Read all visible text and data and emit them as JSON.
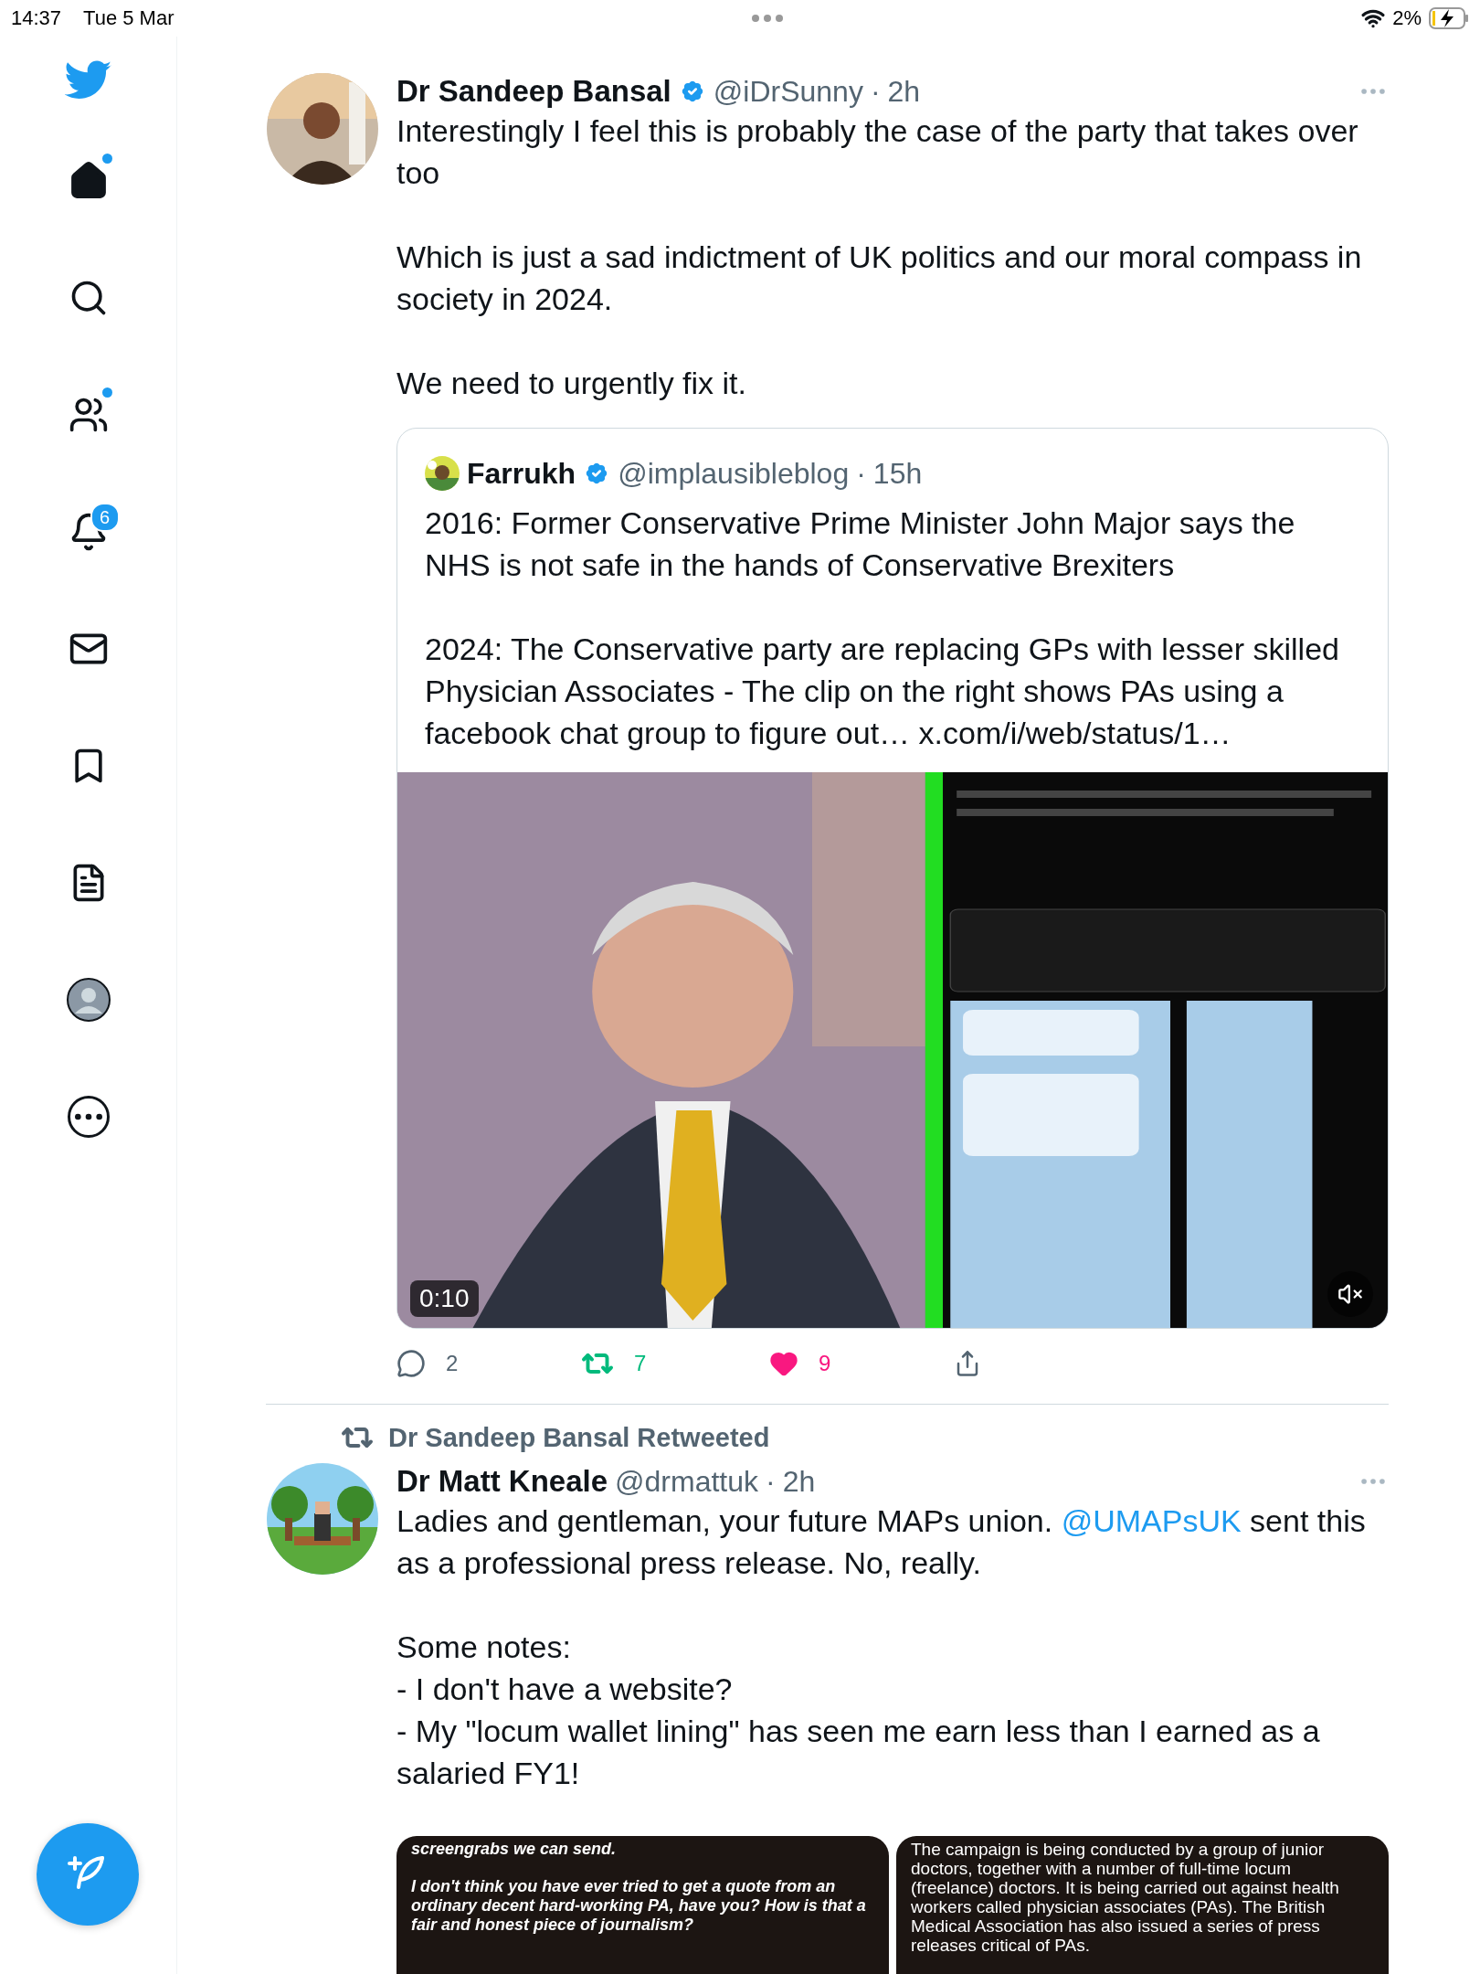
{
  "status_bar": {
    "time": "14:37",
    "date": "Tue 5 Mar",
    "battery": "2%",
    "charging": true
  },
  "sidebar": {
    "items": [
      {
        "kind": "home",
        "selected": true,
        "has_new": true
      },
      {
        "kind": "search",
        "selected": false,
        "has_new": false
      },
      {
        "kind": "communities",
        "selected": false,
        "has_new": true
      },
      {
        "kind": "notifications",
        "selected": false,
        "has_new": false,
        "badge": "6"
      },
      {
        "kind": "messages",
        "selected": false,
        "has_new": false
      },
      {
        "kind": "bookmarks",
        "selected": false,
        "has_new": false
      },
      {
        "kind": "lists",
        "selected": false,
        "has_new": false
      },
      {
        "kind": "profile",
        "selected": false,
        "has_new": false
      },
      {
        "kind": "more",
        "selected": false,
        "has_new": false
      }
    ]
  },
  "tweets": [
    {
      "name": "Dr Sandeep Bansal",
      "verified": true,
      "handle": "@iDrSunny",
      "separator": "·",
      "time": "2h",
      "paragraphs": [
        [
          {
            "text": "Interestingly I feel this is probably the case of the party that takes over too"
          }
        ],
        [
          {
            "text": "Which is just a sad indictment of UK politics and our moral compass in society in 2024."
          }
        ],
        [
          {
            "text": "We need to urgently fix it."
          }
        ]
      ],
      "quote": {
        "name": "Farrukh",
        "verified": true,
        "handle": "@implausibleblog",
        "separator": "·",
        "time": "15h",
        "paragraphs": [
          "2016: Former Conservative Prime Minister John Major says the NHS is not safe in the hands of Conservative Brexiters",
          "2024: The Conservative party are replacing GPs with lesser skilled Physician Associates - The clip on the right shows PAs using a facebook chat group to figure out… x.com/i/web/status/1…"
        ],
        "video": {
          "kind": "picture",
          "duration": "0:10",
          "muted": true
        }
      },
      "actions": {
        "replies": "2",
        "retweets": "7",
        "retweeted": true,
        "likes": "9",
        "liked": true
      }
    },
    {
      "retweeted_by": "Dr Sandeep Bansal Retweeted",
      "name": "Dr Matt Kneale",
      "verified": false,
      "handle": "@drmattuk",
      "separator": "·",
      "time": "2h",
      "paragraphs": [
        [
          {
            "text": "Ladies and gentleman, your future MAPs union. "
          },
          {
            "text": "@UMAPsUK",
            "kind": "mention"
          },
          {
            "text": " sent this as a professional press release. No, really."
          }
        ],
        [
          {
            "text": "Some notes:\n- I don't have a website?\n- My \"locum wallet lining\" has seen me earn less than I earned as a salaried FY1!"
          }
        ]
      ],
      "images": [
        {
          "kind": "italic",
          "paragraphs": [
            "screengrabs we can send.",
            "I don't think you have ever tried to get a quote from an ordinary decent hard-working PA, have you?  How is that a fair and honest piece of journalism?"
          ]
        },
        {
          "kind": "plain",
          "paragraphs": [
            "The campaign is being conducted by a group of junior doctors, together with a number of full-time locum (freelance) doctors. It is being carried out against health workers called physician associates (PAs). The British Medical Association has also issued a series of press releases critical of PAs."
          ]
        }
      ]
    }
  ]
}
